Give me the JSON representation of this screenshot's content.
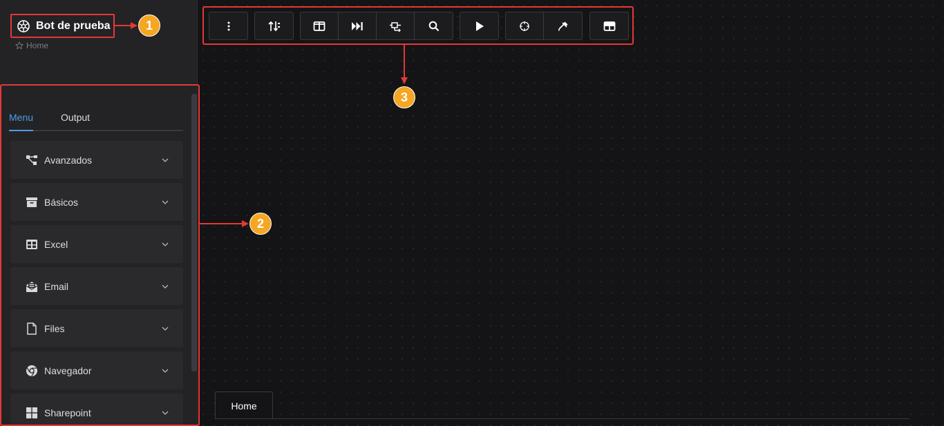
{
  "bot": {
    "title": "Bot de prueba",
    "icon": "aperture-icon"
  },
  "breadcrumb": {
    "icon": "star-icon",
    "label": "Home"
  },
  "sidebar": {
    "tabs": [
      {
        "label": "Menu",
        "active": true
      },
      {
        "label": "Output",
        "active": false
      }
    ],
    "items": [
      {
        "label": "Avanzados",
        "icon": "flow-nodes-icon"
      },
      {
        "label": "Básicos",
        "icon": "archive-box-icon"
      },
      {
        "label": "Excel",
        "icon": "table-grid-icon"
      },
      {
        "label": "Email",
        "icon": "email-open-icon"
      },
      {
        "label": "Files",
        "icon": "file-icon"
      },
      {
        "label": "Navegador",
        "icon": "chrome-icon"
      },
      {
        "label": "Sharepoint",
        "icon": "windows-grid-icon"
      }
    ]
  },
  "toolbar": {
    "groups": [
      [
        "more-vertical-icon"
      ],
      [
        "sort-icon"
      ],
      [
        "columns-icon",
        "skip-forward-icon",
        "swap-icon",
        "search-icon"
      ],
      [
        "play-icon"
      ],
      [
        "crosshair-icon",
        "eyedropper-icon"
      ],
      [
        "table-icon"
      ]
    ]
  },
  "canvas": {
    "tab_label": "Home"
  },
  "annotations": [
    "1",
    "2",
    "3"
  ],
  "colors": {
    "accent": "#4d9ee8",
    "highlight": "#e53935",
    "callout": "#f5a623",
    "background": "#141416",
    "sidebar": "#232326"
  }
}
